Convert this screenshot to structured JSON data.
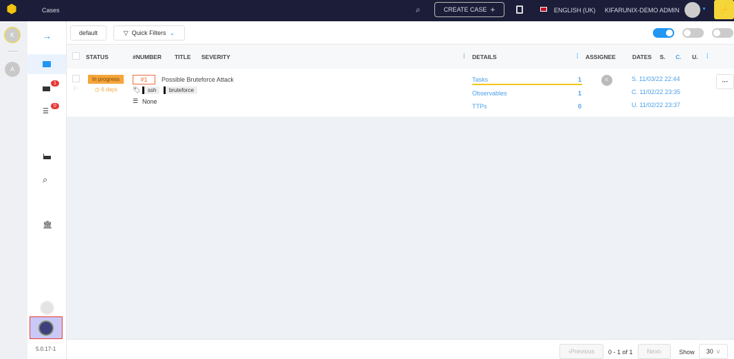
{
  "topbar": {
    "section": "Cases",
    "create_case": "CREATE CASE",
    "language": "ENGLISH (UK)",
    "user": "KIFARUNIX-DEMO ADMIN"
  },
  "strip": {
    "org_avatar": "K",
    "user_avatar": "A"
  },
  "nav": {
    "alerts_count": "1",
    "tasks_count": "0",
    "version": "5.0.17-1"
  },
  "toolbar": {
    "filter_preset": "default",
    "quick_filters": "Quick Filters"
  },
  "table": {
    "columns": {
      "status": "STATUS",
      "number": "#NUMBER",
      "title": "TITLE",
      "severity": "SEVERITY",
      "details": "DETAILS",
      "assignee": "ASSIGNEE",
      "dates": "DATES",
      "s": "S.",
      "c": "C.",
      "u": "U."
    },
    "rows": [
      {
        "status": "In progress",
        "age": "6 days",
        "number": "#1",
        "title": "Possible Bruteforce Attack",
        "tags": [
          "ssh",
          "bruteforce"
        ],
        "custom": "None",
        "details": [
          {
            "label": "Tasks",
            "count": "1"
          },
          {
            "label": "Observables",
            "count": "1"
          },
          {
            "label": "TTPs",
            "count": "0"
          }
        ],
        "assignee": "K",
        "dates": {
          "s": "S. 11/03/22 22:44",
          "c": "C. 11/02/22 23:35",
          "u": "U. 11/02/22 23:37"
        },
        "tasks_progress": 1.0
      }
    ]
  },
  "pagination": {
    "previous": "Previous",
    "range": "0 - 1 of 1",
    "next": "Next",
    "show": "Show",
    "page_size": "30"
  },
  "colors": {
    "topbar": "#1c1d38",
    "accent": "#2196f3",
    "status": "#f6a53a",
    "tasks_bar": "#f5c518"
  }
}
